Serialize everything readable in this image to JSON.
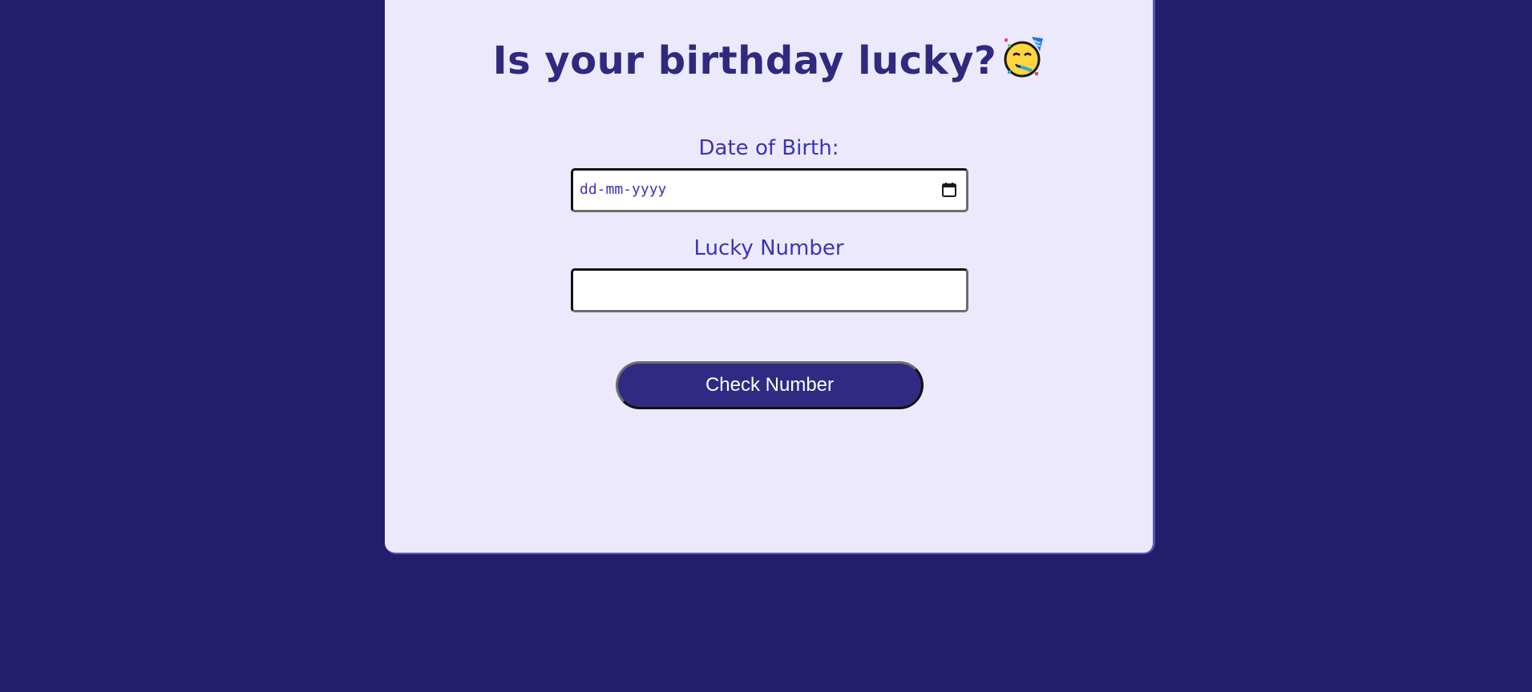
{
  "header": {
    "title": "Is your birthday lucky?",
    "emoji_icon": "partying-face-icon"
  },
  "form": {
    "dob_label": "Date of Birth:",
    "dob_placeholder": "dd-mm-yyyy",
    "dob_icon": "calendar-icon",
    "lucky_label": "Lucky Number",
    "lucky_value": "",
    "submit_label": "Check Number"
  },
  "colors": {
    "background": "#221e6c",
    "card": "#ece9fd",
    "title": "#2f2a7d",
    "label": "#3b33b8",
    "button": "#312a82"
  }
}
